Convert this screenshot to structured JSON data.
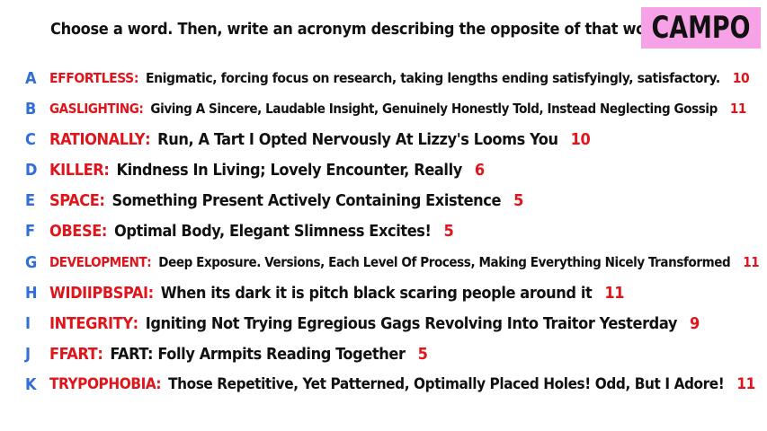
{
  "prompt": "Choose a word. Then, write an acronym describing the opposite of that word!",
  "badge": "CAMPO",
  "colors": {
    "letter": "#2f6fd6",
    "word": "#e0151c",
    "score": "#e0151c",
    "text": "#111111",
    "badge_bg": "#f7a2e6"
  },
  "rows": [
    {
      "letter": "A",
      "word": "EFFORTLESS",
      "acronym": "Enigmatic, forcing focus on research, taking lengths ending satisfyingly, satisfactory.",
      "score": "10"
    },
    {
      "letter": "B",
      "word": "GASLIGHTING",
      "acronym": "Giving A Sincere, Laudable Insight, Genuinely Honestly Told, Instead Neglecting Gossip",
      "score": "11"
    },
    {
      "letter": "C",
      "word": "RATIONALLY",
      "acronym": "Run, A Tart I Opted Nervously At Lizzy's Looms You",
      "score": "10"
    },
    {
      "letter": "D",
      "word": "KILLER",
      "acronym": "Kindness In Living; Lovely Encounter, Really",
      "score": "6"
    },
    {
      "letter": "E",
      "word": "SPACE",
      "acronym": "Something Present Actively Containing Existence",
      "score": "5"
    },
    {
      "letter": "F",
      "word": "OBESE",
      "acronym": "Optimal Body, Elegant Slimness Excites!",
      "score": "5"
    },
    {
      "letter": "G",
      "word": "DEVELOPMENT",
      "acronym": "Deep Exposure. Versions, Each Level Of Process, Making Everything Nicely Transformed",
      "score": "11"
    },
    {
      "letter": "H",
      "word": "WIDIIPBSPAI",
      "acronym": "When its dark it is pitch black scaring people around it",
      "score": "11"
    },
    {
      "letter": "I",
      "word": "INTEGRITY",
      "acronym": "Igniting Not Trying Egregious Gags Revolving Into Traitor Yesterday",
      "score": "9"
    },
    {
      "letter": "J",
      "word": "FFART",
      "acronym": "FART: Folly Armpits Reading Together",
      "score": "5"
    },
    {
      "letter": "K",
      "word": "TRYPOPHOBIA",
      "acronym": "Those Repetitive, Yet Patterned, Optimally Placed Holes! Odd, But I Adore!",
      "score": "11"
    }
  ]
}
